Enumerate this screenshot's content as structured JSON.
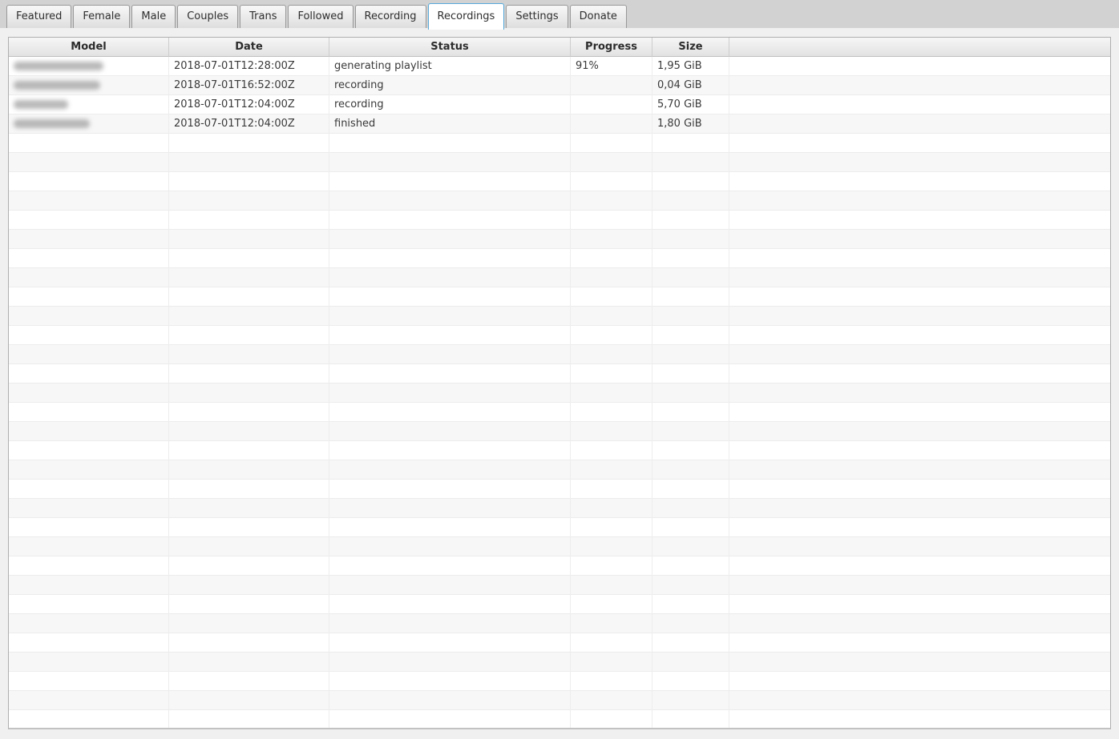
{
  "window": {
    "background": "#f0f0f0",
    "tabbar_background": "#d2d2d2",
    "active_tab_border": "#55a8d8"
  },
  "tabs": {
    "active_label": "Recordings",
    "items": [
      {
        "label": "Featured",
        "active": false
      },
      {
        "label": "Female",
        "active": false
      },
      {
        "label": "Male",
        "active": false
      },
      {
        "label": "Couples",
        "active": false
      },
      {
        "label": "Trans",
        "active": false
      },
      {
        "label": "Followed",
        "active": false
      },
      {
        "label": "Recording",
        "active": false
      },
      {
        "label": "Recordings",
        "active": true
      },
      {
        "label": "Settings",
        "active": false
      },
      {
        "label": "Donate",
        "active": false
      }
    ]
  },
  "table": {
    "columns": [
      {
        "key": "model",
        "label": "Model"
      },
      {
        "key": "date",
        "label": "Date"
      },
      {
        "key": "status",
        "label": "Status"
      },
      {
        "key": "progress",
        "label": "Progress"
      },
      {
        "key": "size",
        "label": "Size"
      },
      {
        "key": "extra",
        "label": ""
      }
    ],
    "rows": [
      {
        "model": "",
        "model_redacted": true,
        "model_blur_width": 112,
        "date": "2018-07-01T12:28:00Z",
        "status": "generating playlist",
        "progress": "91%",
        "size": "1,95 GiB"
      },
      {
        "model": "",
        "model_redacted": true,
        "model_blur_width": 108,
        "date": "2018-07-01T16:52:00Z",
        "status": "recording",
        "progress": "",
        "size": "0,04 GiB"
      },
      {
        "model": "",
        "model_redacted": true,
        "model_blur_width": 68,
        "date": "2018-07-01T12:04:00Z",
        "status": "recording",
        "progress": "",
        "size": "5,70 GiB"
      },
      {
        "model": "",
        "model_redacted": true,
        "model_blur_width": 95,
        "date": "2018-07-01T12:04:00Z",
        "status": "finished",
        "progress": "",
        "size": "1,80 GiB"
      }
    ],
    "empty_row_count": 31,
    "stripe_colors": {
      "even": "#ffffff",
      "odd": "#f7f7f7"
    }
  }
}
